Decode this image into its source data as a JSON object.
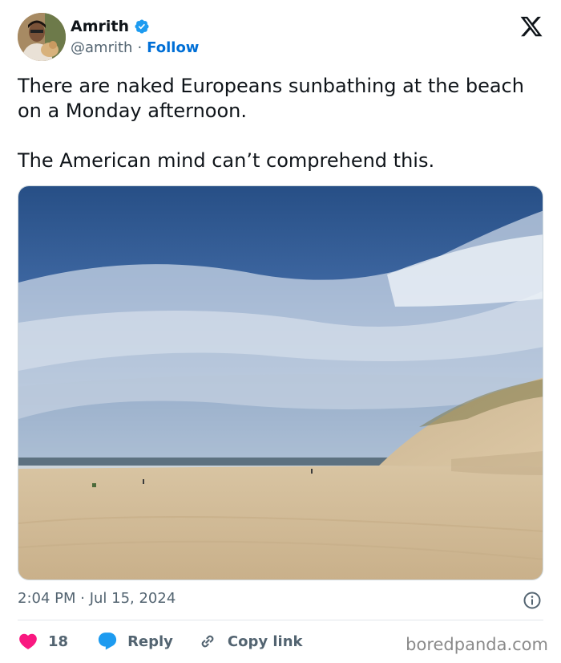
{
  "author": {
    "name": "Amrith",
    "handle": "@amrith",
    "separator": "·",
    "follow_label": "Follow"
  },
  "icons": {
    "verified": "verified-badge-icon",
    "brand": "x-logo-icon",
    "info": "info-icon",
    "like": "heart-icon",
    "reply": "reply-bubble-icon",
    "copy": "link-icon"
  },
  "tweet": {
    "line1": "There are naked Europeans sunbathing at the beach on a Monday afternoon.",
    "line2": "The American mind can’t comprehend this.",
    "timestamp": "2:04 PM · Jul 15, 2024"
  },
  "actions": {
    "like_count": "18",
    "reply_label": "Reply",
    "copy_label": "Copy link"
  },
  "watermark": "boredpanda.com",
  "colors": {
    "accent": "#006fd6",
    "verified": "#1d9bf0",
    "like": "#f91880",
    "reply": "#1d9bf0"
  }
}
